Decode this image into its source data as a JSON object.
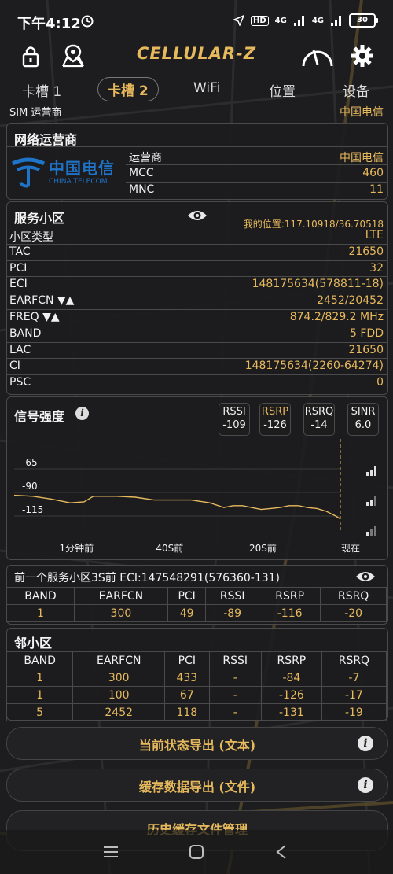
{
  "status_bar": {
    "time": "下午4:12",
    "hd": "HD",
    "net1": "4G",
    "net2": "4G",
    "battery": "30"
  },
  "app": {
    "title": "CELLULAR-Z"
  },
  "tabs": [
    {
      "label": "卡槽 1"
    },
    {
      "label": "卡槽 2"
    },
    {
      "label": "WiFi"
    },
    {
      "label": "位置"
    },
    {
      "label": "设备"
    }
  ],
  "sim": {
    "label": "SIM 运营商",
    "value": "中国电信"
  },
  "operator": {
    "title": "网络运营商",
    "logo_cn": "中国电信",
    "logo_en": "CHINA TELECOM",
    "rows": [
      {
        "k": "运营商",
        "v": "中国电信"
      },
      {
        "k": "MCC",
        "v": "460"
      },
      {
        "k": "MNC",
        "v": "11"
      }
    ]
  },
  "serving": {
    "title": "服务小区",
    "location": "我的位置:117.10918/36.70518",
    "rows": [
      {
        "k": "小区类型",
        "v": "LTE"
      },
      {
        "k": "TAC",
        "v": "21650"
      },
      {
        "k": "PCI",
        "v": "32"
      },
      {
        "k": "ECI",
        "v": "148175634(578811-18)"
      },
      {
        "k": "EARFCN ▼▲",
        "v": "2452/20452"
      },
      {
        "k": "FREQ ▼▲",
        "v": "874.2/829.2 MHz"
      },
      {
        "k": "BAND",
        "v": "5 FDD"
      },
      {
        "k": "LAC",
        "v": "21650"
      },
      {
        "k": "CI",
        "v": "148175634(2260-64274)"
      },
      {
        "k": "PSC",
        "v": "0"
      }
    ]
  },
  "signal": {
    "title": "信号强度",
    "boxes": [
      {
        "name": "RSSI",
        "value": "-109"
      },
      {
        "name": "RSRP",
        "value": "-126"
      },
      {
        "name": "RSRQ",
        "value": "-14"
      },
      {
        "name": "SINR",
        "value": "6.0"
      }
    ]
  },
  "chart_data": {
    "type": "line",
    "title": "",
    "xlabel": "",
    "ylabel": "",
    "yticks": [
      "-65",
      "-90",
      "-115"
    ],
    "ylim": [
      -140,
      -40
    ],
    "xticks": [
      "1分钟前",
      "40S前",
      "20S前",
      "现在"
    ],
    "xlim": [
      -70,
      0
    ],
    "series": [
      {
        "x": [
          -70,
          -66,
          -62,
          -58,
          -55,
          -53,
          -51,
          -48,
          -44,
          -40,
          -36,
          -32,
          -28,
          -25,
          -23,
          -21,
          -19,
          -17,
          -15,
          -13,
          -11,
          -9,
          -7,
          -5,
          -3,
          -1,
          0
        ],
        "values": [
          -93,
          -94,
          -97,
          -101,
          -100,
          -94,
          -94,
          -94,
          -95,
          -98,
          -98,
          -98,
          -101,
          -106,
          -104,
          -104,
          -106,
          -108,
          -107,
          -106,
          -104,
          -104,
          -106,
          -107,
          -110,
          -115,
          -118
        ]
      }
    ],
    "grid": true,
    "line_color": "#e7b95d"
  },
  "previous": {
    "title": "前一个服务小区3S前 ECI:147548291(576360-131)",
    "headers": [
      "BAND",
      "EARFCN",
      "PCI",
      "RSSI",
      "RSRP",
      "RSRQ"
    ],
    "rows": [
      [
        "1",
        "300",
        "49",
        "-89",
        "-116",
        "-20"
      ]
    ]
  },
  "neighbors": {
    "title": "邻小区",
    "headers": [
      "BAND",
      "EARFCN",
      "PCI",
      "RSSI",
      "RSRP",
      "RSRQ"
    ],
    "rows": [
      [
        "1",
        "300",
        "433",
        "-",
        "-84",
        "-7"
      ],
      [
        "1",
        "100",
        "67",
        "-",
        "-126",
        "-17"
      ],
      [
        "5",
        "2452",
        "118",
        "-",
        "-131",
        "-19"
      ]
    ]
  },
  "buttons": [
    {
      "label": "当前状态导出 (文本)",
      "info": "i"
    },
    {
      "label": "缓存数据导出 (文件)",
      "info": "i"
    },
    {
      "label": "历史缓存文件管理",
      "info": ""
    }
  ],
  "colors": {
    "accent": "#e7b95d",
    "background": "#1b1b1c",
    "telecom_blue": "#1e74c9"
  }
}
